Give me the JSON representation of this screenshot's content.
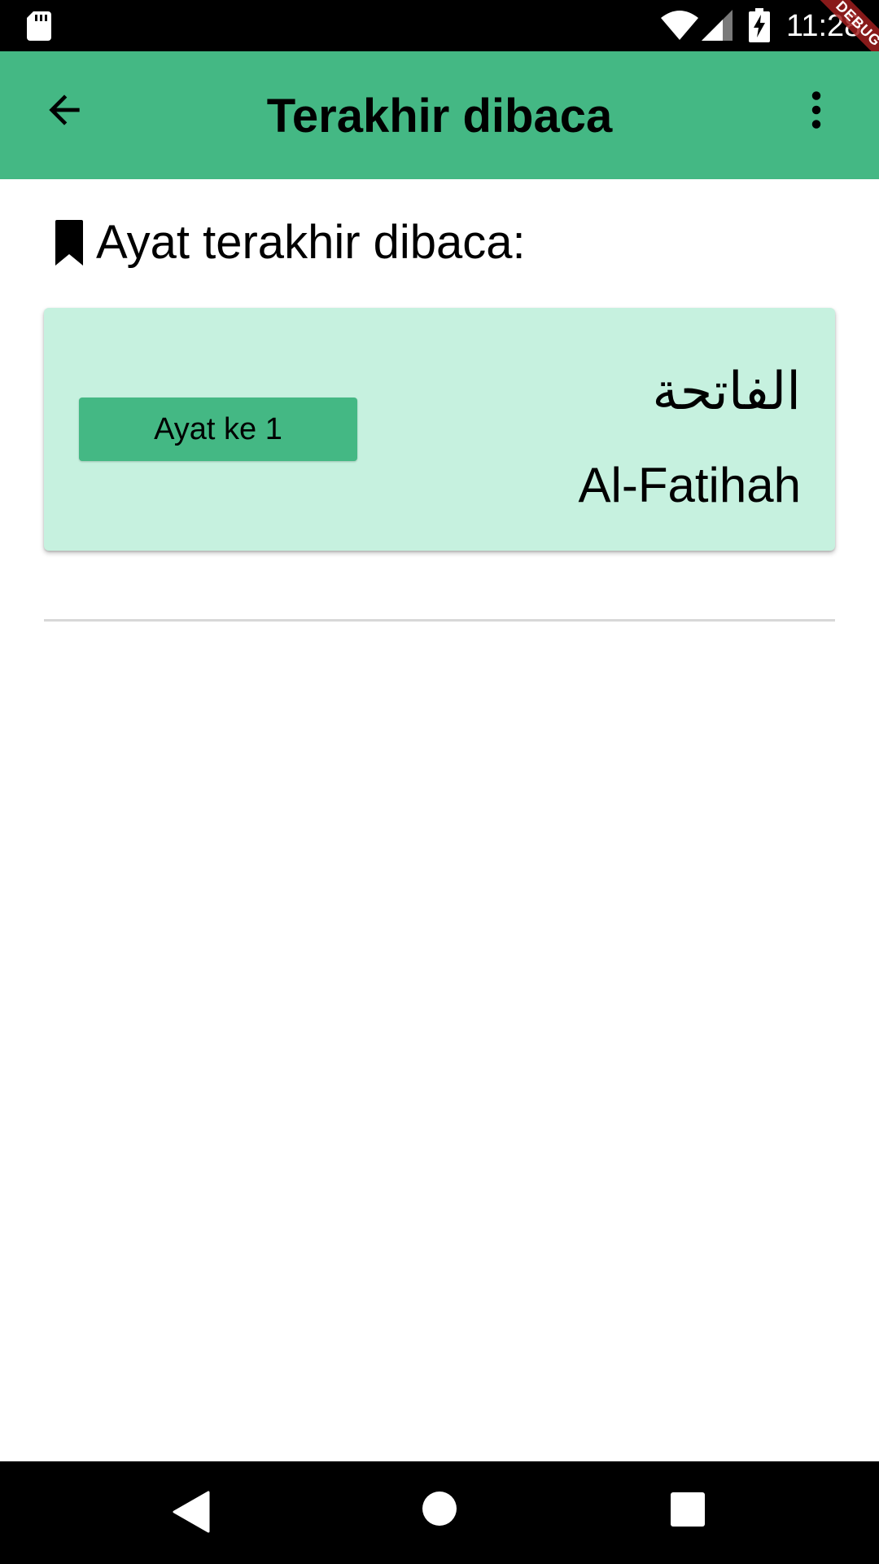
{
  "status_bar": {
    "time": "11:28",
    "icons": [
      "sd-card-icon",
      "wifi-icon",
      "signal-icon",
      "battery-charging-icon"
    ],
    "debug_banner": "DEBUG"
  },
  "app_bar": {
    "title": "Terakhir dibaca",
    "back_icon": "arrow-back-icon",
    "menu_icon": "more-vert-icon",
    "background_color": "#44b884"
  },
  "content": {
    "heading_icon": "bookmark-icon",
    "heading": "Ayat terakhir dibaca:",
    "last_read": {
      "ayat_button_label": "Ayat ke 1",
      "surah_arabic": "الفاتحة",
      "surah_latin": "Al-Fatihah",
      "card_color": "#c6f1df",
      "button_color": "#44b884"
    }
  },
  "nav_bar": {
    "icons": [
      "nav-back-icon",
      "nav-home-icon",
      "nav-recents-icon"
    ]
  }
}
